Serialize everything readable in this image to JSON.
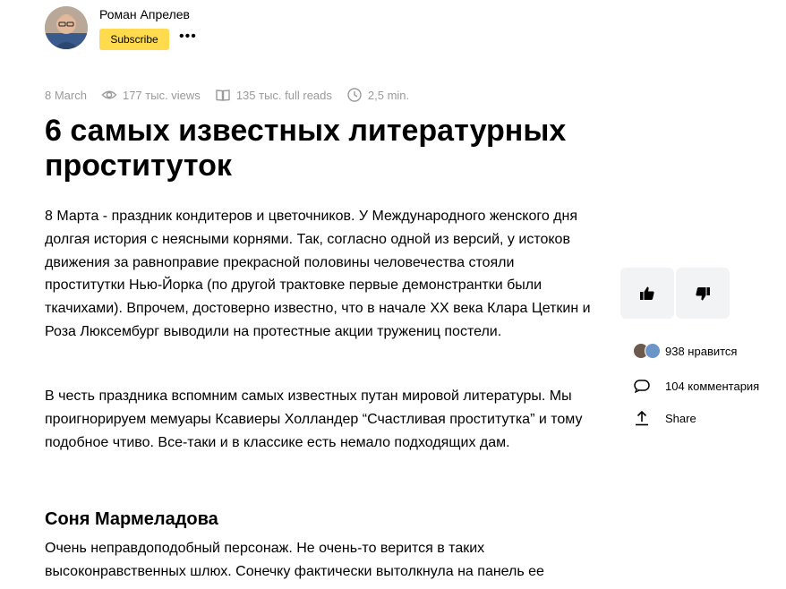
{
  "author": {
    "name": "Роман Апрелев",
    "subscribe_label": "Subscribe",
    "more_label": "•••",
    "avatar_icon": "author-avatar"
  },
  "meta": {
    "date": "8 March",
    "views": "177 тыс. views",
    "full_reads": "135 тыс. full reads",
    "read_time": "2,5 min."
  },
  "article": {
    "title": "6 самых известных литературных проституток",
    "paragraphs": [
      "8 Марта - праздник кондитеров и цветочников. У Международного женского дня долгая история с неясными корнями. Так, согласно одной из версий, у истоков движения за равноправие прекрасной половины человечества стояли проститутки Нью-Йорка (по другой трактовке первые демонстрантки были ткачихами). Впрочем, достоверно известно, что в начале XX века Клара Цеткин и Роза Люксембург выводили на протестные акции тружениц постели.",
      "В честь праздника вспомним самых известных путан мировой литературы. Мы проигнорируем мемуары Ксавиеры Холландер “Счастливая проститутка” и тому подобное чтиво. Все-таки и в классике есть немало подходящих дам."
    ],
    "section_heading": "Соня Мармеладова",
    "section_paragraph": "Очень неправдоподобный персонаж. Не очень-то верится в таких высоконравственных шлюх. Сонечку фактически вытолкнула на панель ее"
  },
  "sidebar": {
    "likes_text": "938 нравится",
    "comments_text": "104 комментария",
    "share_label": "Share"
  },
  "colors": {
    "accent": "#ffdb4d",
    "muted": "#9a9a9a",
    "reaction_bg": "#f2f3f5"
  }
}
